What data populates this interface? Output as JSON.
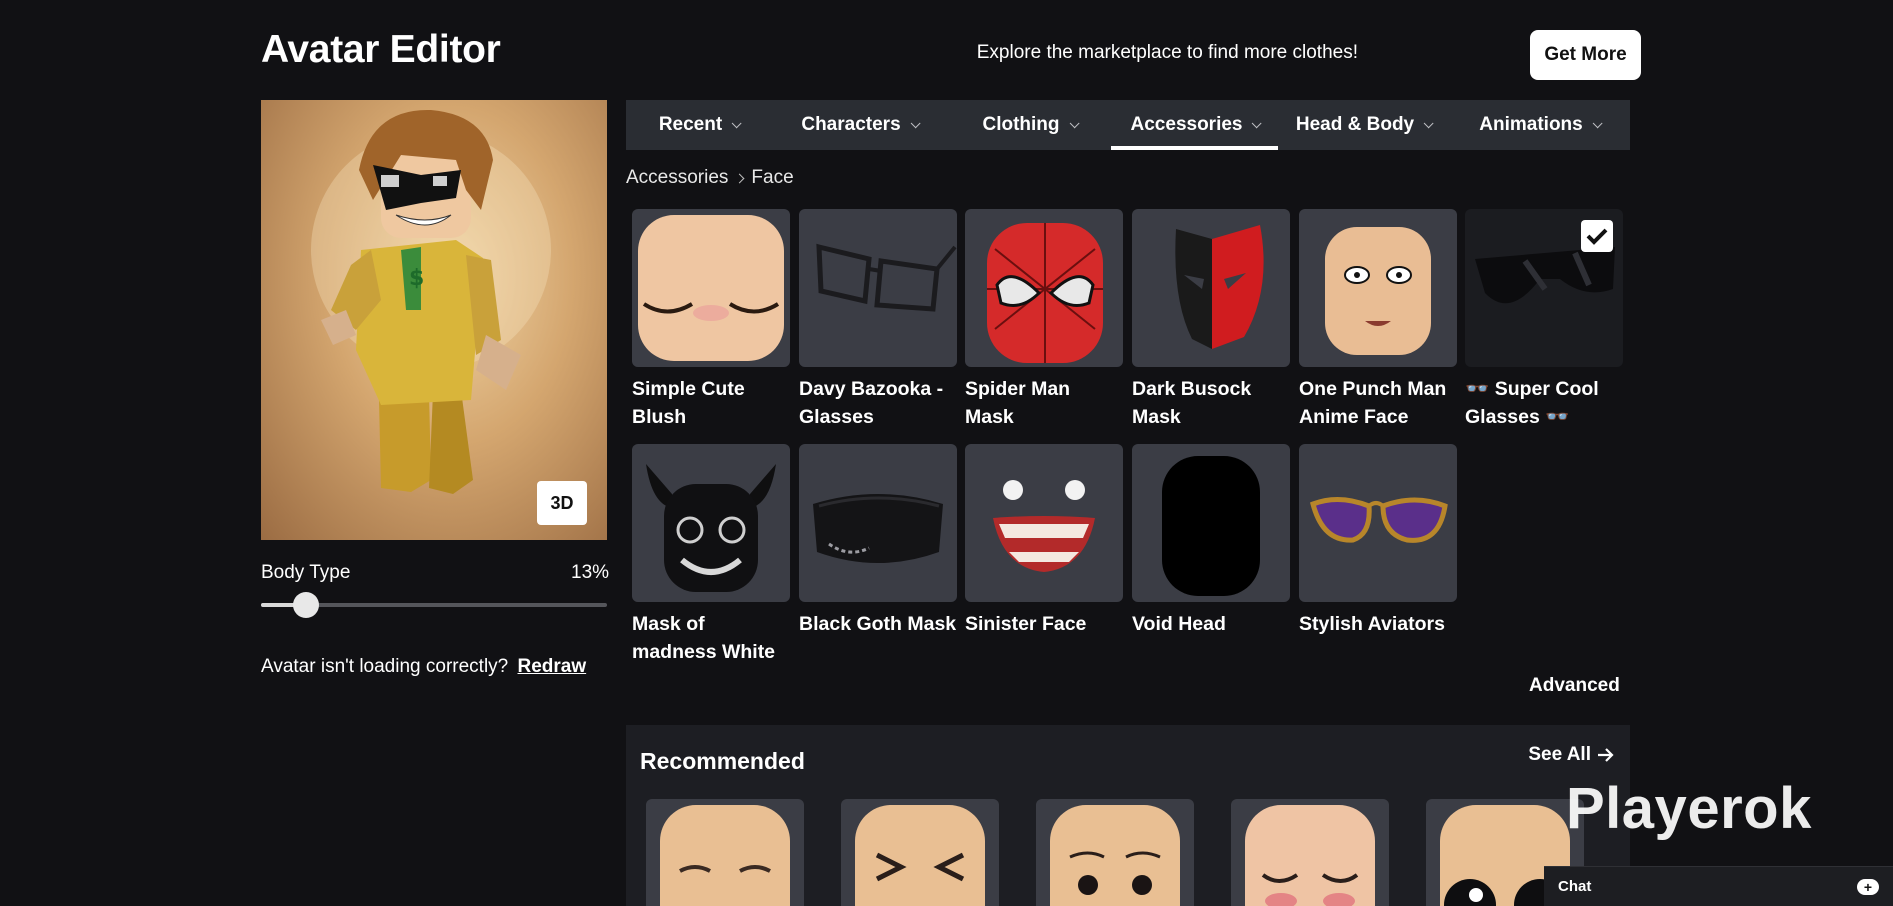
{
  "header": {
    "title": "Avatar Editor",
    "promo_text": "Explore the marketplace to find more clothes!",
    "get_more_label": "Get More"
  },
  "preview": {
    "view_mode_label": "3D",
    "body_type_label": "Body Type",
    "body_type_value": "13%",
    "body_type_fraction": 0.13,
    "loading_question": "Avatar isn't loading correctly?",
    "redraw_label": "Redraw"
  },
  "tabs": [
    {
      "label": "Recent",
      "active": false
    },
    {
      "label": "Characters",
      "active": false
    },
    {
      "label": "Clothing",
      "active": false
    },
    {
      "label": "Accessories",
      "active": true
    },
    {
      "label": "Head & Body",
      "active": false
    },
    {
      "label": "Animations",
      "active": false
    }
  ],
  "breadcrumb": {
    "parent": "Accessories",
    "current": "Face"
  },
  "items": [
    {
      "name": "Simple Cute Blush",
      "selected": false
    },
    {
      "name": "Davy Bazooka - Glasses",
      "selected": false
    },
    {
      "name": "Spider Man Mask",
      "selected": false
    },
    {
      "name": "Dark Busock Mask",
      "selected": false
    },
    {
      "name": "One Punch Man Anime Face",
      "selected": false
    },
    {
      "name": "👓 Super Cool Glasses 👓",
      "selected": true
    },
    {
      "name": "Mask of madness White",
      "selected": false
    },
    {
      "name": "Black Goth Mask",
      "selected": false
    },
    {
      "name": "Sinister Face",
      "selected": false
    },
    {
      "name": "Void Head",
      "selected": false
    },
    {
      "name": "Stylish Aviators",
      "selected": false
    }
  ],
  "advanced_label": "Advanced",
  "recommended": {
    "title": "Recommended",
    "see_all_label": "See All"
  },
  "watermark": "Playerok",
  "chat": {
    "label": "Chat"
  },
  "colors": {
    "background": "#111114",
    "tabbar": "#2a2d33",
    "tile": "#3b3d45"
  }
}
